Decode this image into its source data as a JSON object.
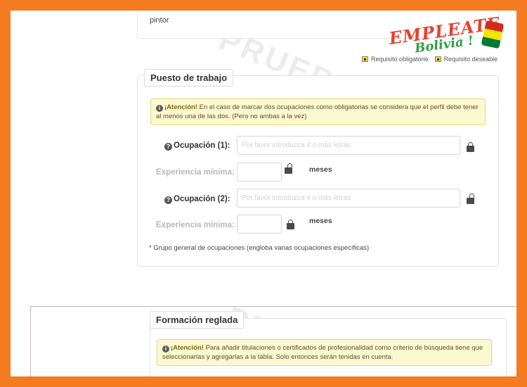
{
  "prev_section": {
    "value": "pintor"
  },
  "logo": {
    "line1": "EMPLEATE",
    "line2": "Bolivia !"
  },
  "legend": {
    "required": "Requisito obligatorio",
    "desirable": "Requisito deseable"
  },
  "watermark": "PRUEBAS",
  "puesto": {
    "title": "Puesto de trabajo",
    "alert_strong": "¡Atención!",
    "alert_text": " En el caso de marcar dos ocupaciones como obligatorias se considera que el perfil debe tener al menos una de las dos. (Pero no ambas a la vez)",
    "occ1_label": "Ocupación (1):",
    "occ2_label": "Ocupación (2):",
    "placeholder": "Por favor introduzca 4 o más letras",
    "occ1_value": "",
    "occ2_value": "",
    "exp_label": "Experiencia mínima:",
    "exp1_value": "",
    "exp2_value": "",
    "unit": "meses",
    "note": "* Grupo general de ocupaciones (engloba varias ocupaciones específicas)"
  },
  "formacion": {
    "title": "Formación reglada",
    "alert_strong": "¡Atención!",
    "alert_text": " Para añadir titulaciones o certificados de profesionalidad como criterio de búsqueda tiene que seleccionarlas y agregarlas a la tabla. Solo entonces serán tenidas en cuenta."
  },
  "colors": {
    "frame": "#f47b20",
    "alert_bg": "#fcf8d0",
    "alert_border": "#e2da6e",
    "logo_red": "#e8412c",
    "logo_green": "#2f9e41"
  }
}
